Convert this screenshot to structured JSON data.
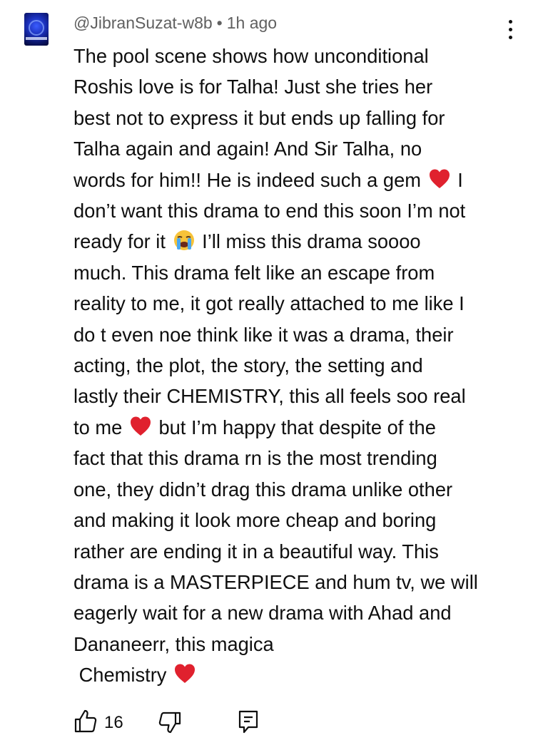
{
  "comment": {
    "author": "@JibranSuzat-w8b",
    "separator": "•",
    "time_ago": "1h ago",
    "text_segments": [
      "The pool scene shows how unconditional\nRoshis love is for Talha! Just she tries her\nbest not to express it but ends up falling for\nTalha again and again! And Sir Talha, no\nwords for him!! He is indeed such a gem ",
      " I\ndon’t want this drama to end this soon I’m not\nready for it ",
      " I’ll miss this drama soooo\nmuch. This drama felt like an escape from\nreality to me, it got really attached to me like I\ndo t even noe think like it was a drama, their\nacting, the plot, the story, the setting and\nlastly their CHEMISTRY, this all feels soo real\nto me ",
      " but I’m happy that despite of the\nfact that this drama rn is the most trending\none, they didn’t drag this drama unlike other\nand making it look more cheap and boring\nrather are ending it in a beautiful way. This\ndrama is a MASTERPIECE and hum tv, we will\neagerly wait for a new drama with Ahad and\nDananeerr, this magica\n Chemistry "
    ],
    "emoji": {
      "heart": "red-heart-icon",
      "crying": "loudly-crying-face-icon"
    },
    "like_count": "16"
  },
  "icons": {
    "menu": "more-vert-icon",
    "like": "thumb-up-icon",
    "dislike": "thumb-down-icon",
    "reply": "reply-comment-icon"
  },
  "colors": {
    "text": "#0f0f0f",
    "meta": "#606060",
    "heart": "#e0212e",
    "avatar": "#1a2fb8"
  }
}
